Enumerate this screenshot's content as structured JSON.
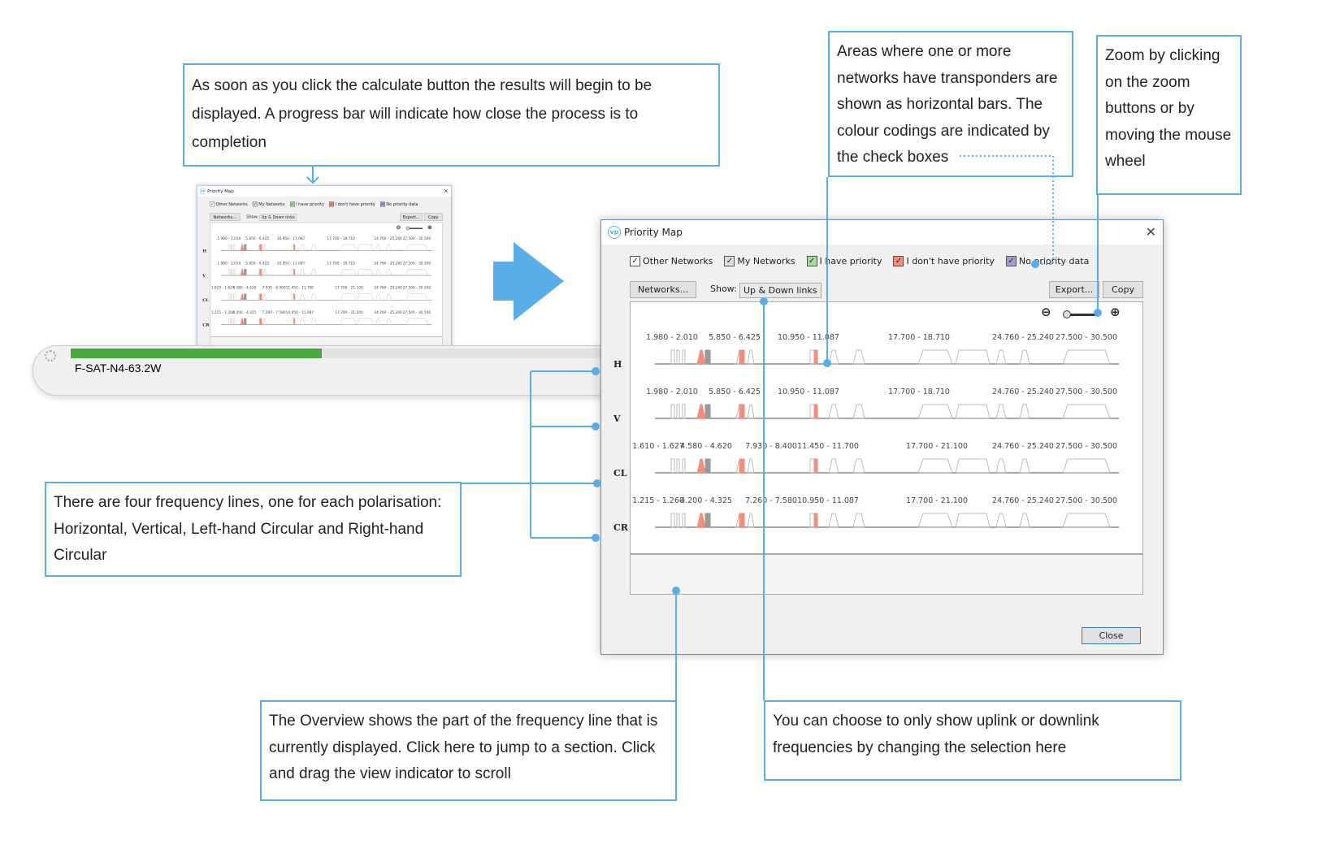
{
  "callouts": {
    "calculate": "As soon as you click the calculate button the results will begin to be displayed. A progress bar will indicate how close the process is to completion",
    "bars": "Areas where one or more networks have transponders are shown as horizontal bars. The colour codings are indicated by the check boxes",
    "zoom": "Zoom by clicking on the zoom buttons or by moving the mouse wheel",
    "lines": "There are four frequency lines, one for each polarisation: Horizontal, Vertical, Left-hand Circular and Right-hand Circular",
    "overview": "The Overview shows the part of the frequency line that is currently displayed. Click here to jump to a section. Click and drag the view indicator to scroll",
    "show": "You can choose to only show uplink or downlink frequencies by changing the selection here"
  },
  "progress": {
    "label": "F-SAT-N4-63.2W",
    "value_percent": 46,
    "color": "#4aa93e"
  },
  "window": {
    "title": "Priority Map",
    "checkboxes": [
      {
        "label": "Other Networks",
        "checked": true,
        "color": "#ffffff"
      },
      {
        "label": "My Networks",
        "checked": true,
        "color": "#dddddd"
      },
      {
        "label": "I have priority",
        "checked": true,
        "color": "#a8d8a0"
      },
      {
        "label": "I don't have priority",
        "checked": true,
        "color": "#f0907c"
      },
      {
        "label": "No priority data",
        "checked": true,
        "color": "#a89ad0"
      }
    ],
    "networks_button": "Networks...",
    "show_label": "Show:",
    "show_value": "Up & Down links",
    "export_button": "Export...",
    "copy_button": "Copy",
    "close_button": "Close",
    "zoom_level": 1.0,
    "lines": [
      {
        "pol": "H",
        "labels": [
          "1.980 - 2.010",
          "5.850 - 6.425",
          "10.950 - 11.087",
          "17.700 - 18.710",
          "24.760 - 25.240",
          "27.500 - 30.500"
        ]
      },
      {
        "pol": "V",
        "labels": [
          "1.980 - 2.010",
          "5.850 - 6.425",
          "10.950 - 11.087",
          "17.700 - 18.710",
          "24.760 - 25.240",
          "27.500 - 30.500"
        ]
      },
      {
        "pol": "CL",
        "labels": [
          "1.610 - 1.627",
          "4.580 - 4.620",
          "7.930 - 8.400",
          "11.450 - 11.700",
          "17.700 - 21.100",
          "24.760 - 25.240",
          "27.500 - 30.500"
        ]
      },
      {
        "pol": "CR",
        "labels": [
          "1.215 - 1.260",
          "4.200 - 4.325",
          "7.260 - 7.580",
          "10.950 - 11.087",
          "17.700 - 21.100",
          "24.760 - 25.240",
          "27.500 - 30.500"
        ]
      }
    ]
  },
  "colors": {
    "accent": "#5aaee8",
    "no_priority": "#f0907c",
    "other": "#cccccc"
  }
}
